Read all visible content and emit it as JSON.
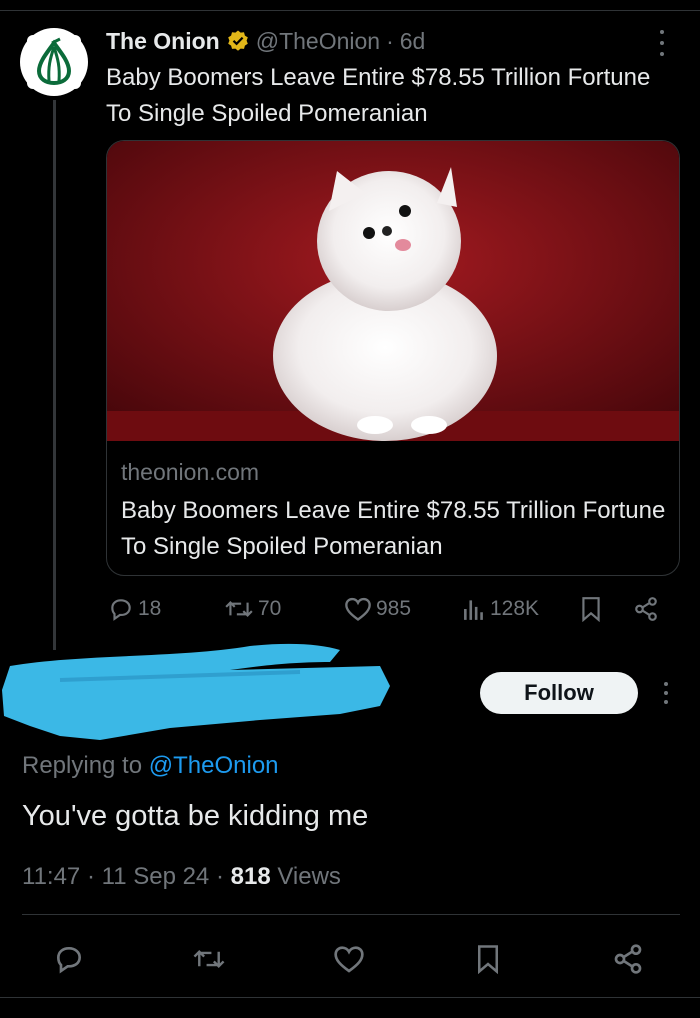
{
  "quoted_tweet": {
    "author_name": "The Onion",
    "handle": "@TheOnion",
    "separator": "·",
    "time_ago": "6d",
    "text": "Baby Boomers Leave Entire $78.55 Trillion Fortune To Single Spoiled Pomeranian",
    "card": {
      "domain": "theonion.com",
      "title": "Baby Boomers Leave Entire $78.55 Trillion Fortune To Single Spoiled Pomeranian",
      "image_description_icon": "pomeranian-photo"
    },
    "stats": {
      "replies": "18",
      "retweets": "70",
      "likes": "985",
      "views": "128K"
    },
    "avatar_icon": "onion-logo",
    "verified_icon": "verified-badge-gold"
  },
  "reply_tweet": {
    "follow_label": "Follow",
    "replying_prefix": "Replying to",
    "replying_mention": "@TheOnion",
    "text": "You've gotta be kidding me",
    "time": "11:47",
    "date": "11 Sep 24",
    "views_count": "818",
    "views_label": "Views",
    "separator": "·"
  },
  "colors": {
    "background": "#000000",
    "text_primary": "#e7e9ea",
    "text_secondary": "#71767b",
    "link": "#1d9bf0",
    "verified_gold": "#e2b719",
    "onion_green": "#0b6b3a",
    "redaction": "#3bb8e6",
    "photo_bg": "#7a0f14"
  }
}
